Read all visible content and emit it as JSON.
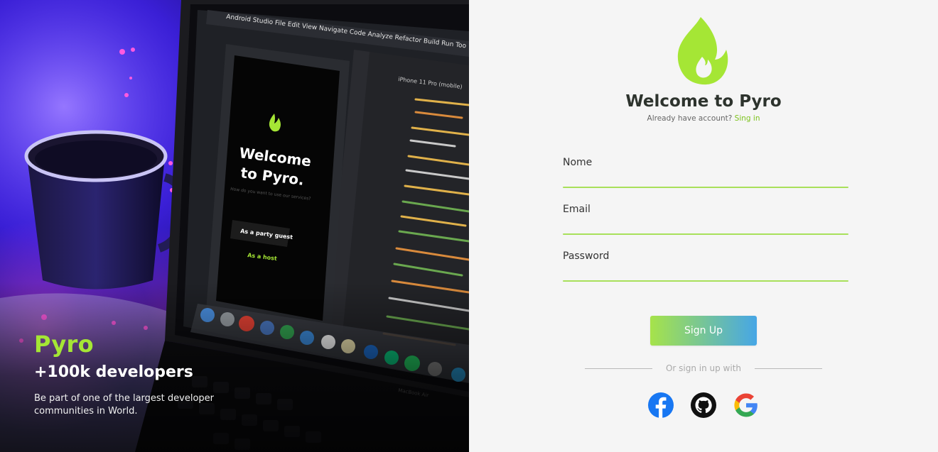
{
  "hero": {
    "brand": "Pyro",
    "headline": "+100k developers",
    "description": "Be part of one of the largest developer communities in World.",
    "screen_app_name": "Android Studio",
    "screen_menu": [
      "File",
      "Edit",
      "View",
      "Navigate",
      "Code",
      "Analyze",
      "Refactor",
      "Build",
      "Run",
      "Too"
    ],
    "device_label": "iPhone 11 Pro (mobile)",
    "phone_title_line1": "Welcome",
    "phone_title_line2": "to Pyro.",
    "phone_subtitle": "How do you want to use our services?",
    "phone_primary": "As a party guest",
    "phone_secondary": "As a host",
    "laptop_brand": "MacBook Air"
  },
  "form": {
    "title": "Welcome to Pyro",
    "already_text": "Already have account?",
    "signin_link": "Sing in",
    "fields": [
      {
        "label": "Nome"
      },
      {
        "label": "Email"
      },
      {
        "label": "Password"
      }
    ],
    "signup_label": "Sign Up",
    "divider_text": "Or sign in up with",
    "social": [
      "facebook-icon",
      "github-icon",
      "google-icon"
    ]
  },
  "colors": {
    "accent_green": "#a5e635",
    "gradient_blue": "#46a6e6",
    "facebook": "#1877f2"
  }
}
